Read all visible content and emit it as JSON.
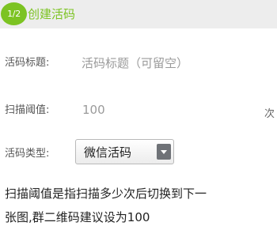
{
  "header": {
    "step": "1/2",
    "title": "创建活码"
  },
  "form": {
    "title_label": "活码标题:",
    "title_placeholder": "活码标题（可留空）",
    "threshold_label": "扫描阈值:",
    "threshold_value": "100",
    "threshold_unit": "次",
    "type_label": "活码类型:",
    "type_value": "微信活码"
  },
  "help": {
    "line1": "扫描阈值是指扫描多少次后切换到下一",
    "line2": "张图,群二维码建议设为100"
  },
  "colors": {
    "accent": "#7cc322",
    "header_bg": "#ededed"
  }
}
